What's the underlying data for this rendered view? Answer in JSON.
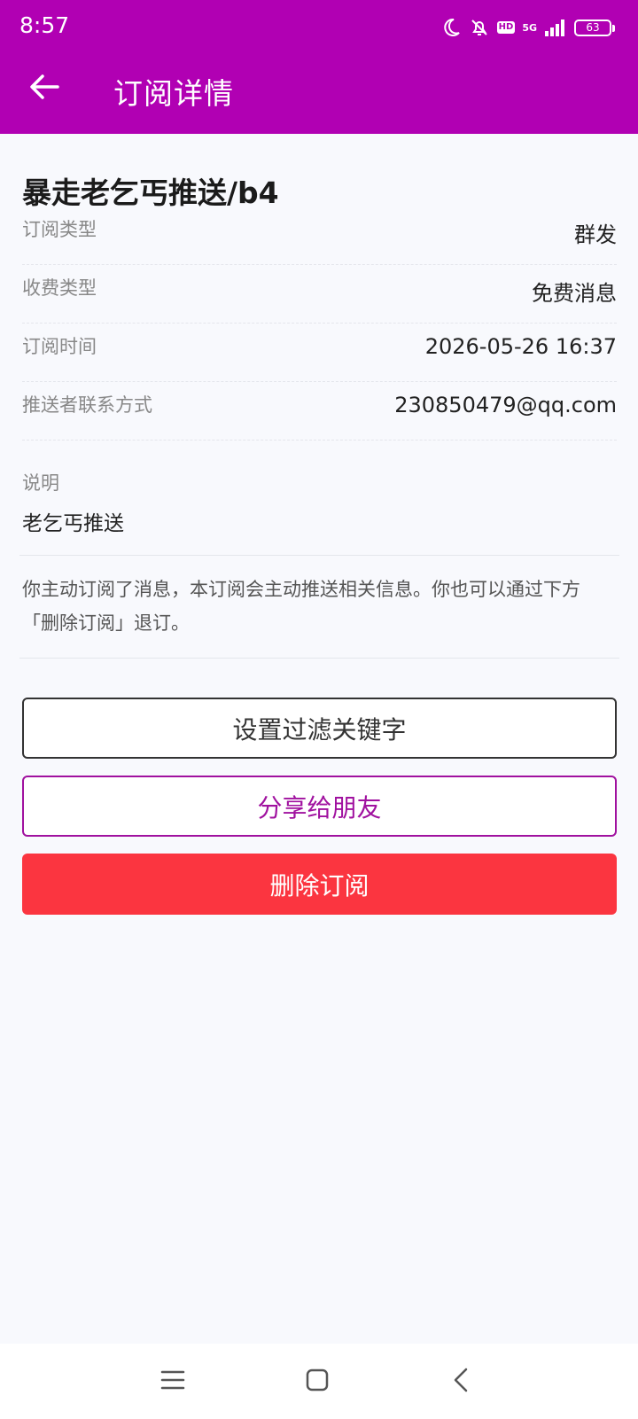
{
  "status_bar": {
    "time": "8:57",
    "hd_label": "HD",
    "network_label": "5G",
    "battery": "63",
    "icons": [
      "moon-icon",
      "bell-off-icon",
      "hd-icon",
      "signal-icon",
      "battery-icon"
    ]
  },
  "header": {
    "title": "订阅详情",
    "back_icon": "arrow-left-icon"
  },
  "subscription": {
    "name": "暴走老乞丐推送/b4",
    "rows": [
      {
        "label": "订阅类型",
        "value": "群发"
      },
      {
        "label": "收费类型",
        "value": "免费消息"
      },
      {
        "label": "订阅时间",
        "value": "2026-05-26 16:37"
      },
      {
        "label": "推送者联系方式",
        "value": "230850479@qq.com"
      }
    ],
    "description_label": "说明",
    "description_value": "老乞丐推送",
    "notice": "你主动订阅了消息，本订阅会主动推送相关信息。你也可以通过下方「删除订阅」退订。"
  },
  "actions": {
    "filter_label": "设置过滤关键字",
    "share_label": "分享给朋友",
    "delete_label": "删除订阅"
  },
  "colors": {
    "header_bg": "#b100b3",
    "share_accent": "#a0119f",
    "delete_bg": "#fb3540",
    "page_bg": "#f8f9fd"
  },
  "nav_bar": {
    "icons": [
      "menu-icon",
      "home-square-icon",
      "back-chevron-icon"
    ]
  }
}
